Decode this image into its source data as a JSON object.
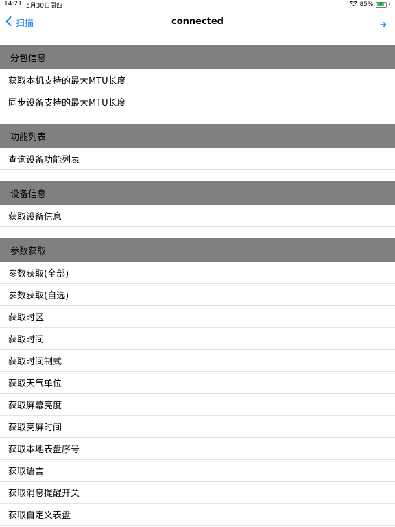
{
  "status_bar": {
    "time": "14:21",
    "date": "5月30日周四",
    "battery_percent": "85%",
    "battery_level": 0.85,
    "battery_color": "#34c759",
    "wifi_icon": "wifi-icon"
  },
  "nav": {
    "back_label": "扫描",
    "title": "connected",
    "next_icon": "arrow-right-icon",
    "accent_color": "#1a82fb"
  },
  "sections": [
    {
      "header": "分包信息",
      "items": [
        "获取本机支持的最大MTU长度",
        "同步设备支持的最大MTU长度"
      ]
    },
    {
      "header": "功能列表",
      "items": [
        "查询设备功能列表"
      ]
    },
    {
      "header": "设备信息",
      "items": [
        "获取设备信息"
      ]
    },
    {
      "header": "参数获取",
      "items": [
        "参数获取(全部)",
        "参数获取(自选)",
        "获取时区",
        "获取时间",
        "获取时间制式",
        "获取天气单位",
        "获取屏幕亮度",
        "获取亮屏时间",
        "获取本地表盘序号",
        "获取语言",
        "获取消息提醒开关",
        "获取自定义表盘"
      ]
    }
  ],
  "colors": {
    "section_header_bg": "#808080",
    "separator": "#e3e3e8"
  }
}
